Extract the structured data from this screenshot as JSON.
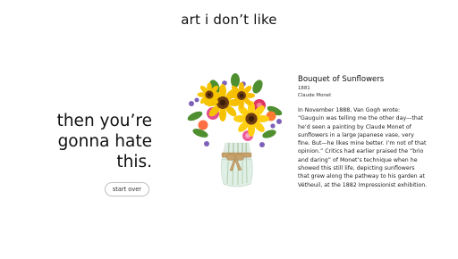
{
  "header": {
    "title": "art i don’t like"
  },
  "left_panel": {
    "headline": "then you’re\ngonna hate this.",
    "start_over_label": "start over"
  },
  "artwork": {
    "image_description": "bouquet-of-sunflowers-in-vase"
  },
  "info": {
    "title": "Bouquet of Sunflowers",
    "year": "1881",
    "artist": "Claude Monet",
    "description": "In November 1888, Van Gogh wrote: “Gauguin was telling me the other day—that he’d seen a painting by Claude Monet of sunflowers in a large Japanese vase, very fine. But—he likes mine better. I’m not of that opinion.” Critics had earlier praised the “brio and daring” of Monet’s technique when he showed this still life, depicting sunflowers that grew along the pathway to his garden at Vétheuil, at the 1882 Impressionist exhibition."
  },
  "colors": {
    "background": "#ffffff",
    "text": "#111111",
    "button_border": "#bdbdbd"
  }
}
